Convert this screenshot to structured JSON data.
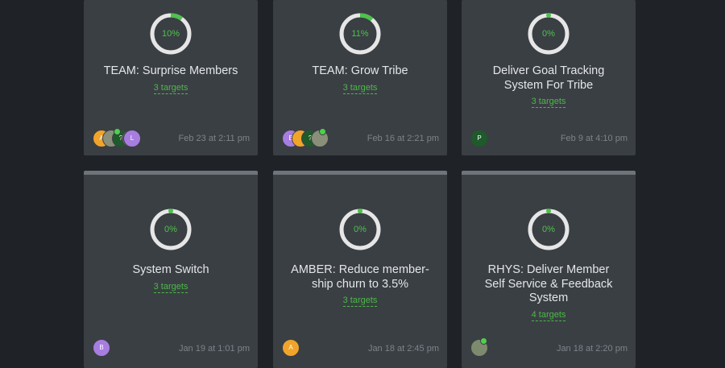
{
  "cards": [
    {
      "percent": "10%",
      "progress": 0.1,
      "title": "TEAM: Surprise Members",
      "targets": "3 targets",
      "date": "Feb 23 at 2:11 pm",
      "avatars": [
        "A",
        "",
        "?",
        "",
        "L"
      ]
    },
    {
      "percent": "11%",
      "progress": 0.11,
      "title": "TEAM: Grow Tribe",
      "targets": "3 targets",
      "date": "Feb 16 at 2:21 pm",
      "avatars": [
        "B",
        "",
        "?",
        ""
      ]
    },
    {
      "percent": "0%",
      "progress": 0,
      "title": "Deliver Goal Tracking System For Tribe",
      "targets": "3 targets",
      "date": "Feb 9 at 4:10 pm",
      "avatars": [
        "P"
      ]
    },
    {
      "percent": "0%",
      "progress": 0,
      "title": "System Switch",
      "targets": "3 targets",
      "date": "Jan 19 at 1:01 pm",
      "avatars": [
        "B"
      ]
    },
    {
      "percent": "0%",
      "progress": 0,
      "title": "AMBER: Reduce member-ship churn to 3.5%",
      "targets": "3 targets",
      "date": "Jan 18 at 2:45 pm",
      "avatars": [
        "A"
      ]
    },
    {
      "percent": "0%",
      "progress": 0,
      "title": "RHYS: Deliver Member Self Service & Feedback System",
      "targets": "4 targets",
      "date": "Jan 18 at 2:20 pm",
      "avatars": [
        ""
      ]
    }
  ],
  "colors": {
    "background": "#1f2327",
    "card": "#3a3f44",
    "accent_green": "#4cc24a",
    "ring_track": "#e6e6e6",
    "avatar_orange": "#f0a42a",
    "avatar_purple": "#a77de0",
    "avatar_dark_green": "#1f5a2a"
  }
}
